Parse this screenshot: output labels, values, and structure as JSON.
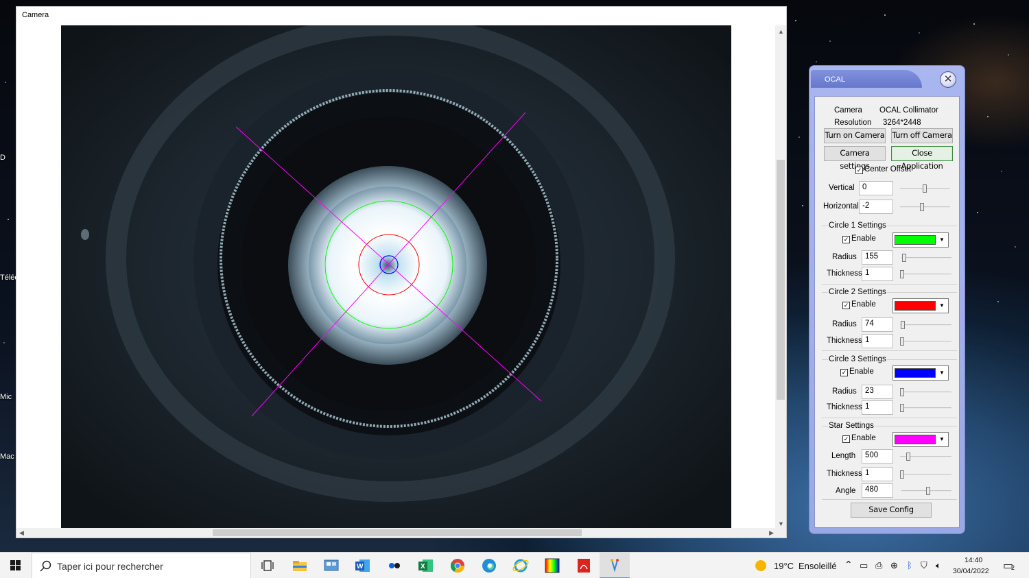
{
  "desktop": {
    "labels": [
      "D",
      "Téléc",
      "Mic",
      "Mac"
    ]
  },
  "camera_window": {
    "title": "Camera"
  },
  "ocal": {
    "title": "OCAL",
    "camera_label": "Camera",
    "camera_value": "OCAL Collimator",
    "resolution_label": "Resolution",
    "resolution_value": "3264*2448",
    "buttons": {
      "turn_on": "Turn on Camera",
      "turn_off": "Turn off Camera",
      "settings": "Camera settings",
      "close_app": "Close Application",
      "save": "Save Config"
    },
    "center_offset": {
      "label": "Center Offset",
      "checked": true,
      "vertical_label": "Vertical",
      "vertical_value": "0",
      "horizontal_label": "Horizontal",
      "horizontal_value": "-2"
    },
    "circle1": {
      "title": "Circle 1 Settings",
      "enable_label": "Enable",
      "color": "#00ff00",
      "radius_label": "Radius",
      "radius": "155",
      "thickness_label": "Thickness",
      "thickness": "1"
    },
    "circle2": {
      "title": "Circle 2 Settings",
      "enable_label": "Enable",
      "color": "#ff0000",
      "radius_label": "Radius",
      "radius": "74",
      "thickness_label": "Thickness",
      "thickness": "1"
    },
    "circle3": {
      "title": "Circle 3 Settings",
      "enable_label": "Enable",
      "color": "#0000ff",
      "radius_label": "Radius",
      "radius": "23",
      "thickness_label": "Thickness",
      "thickness": "1"
    },
    "star": {
      "title": "Star Settings",
      "enable_label": "Enable",
      "color": "#ff00ff",
      "length_label": "Length",
      "length": "500",
      "thickness_label": "Thickness",
      "thickness": "1",
      "angle_label": "Angle",
      "angle": "480"
    }
  },
  "taskbar": {
    "search_placeholder": "Taper ici pour rechercher",
    "weather_temp": "19°C",
    "weather_text": "Ensoleillé",
    "time": "14:40",
    "date": "30/04/2022",
    "notification_count": "2",
    "pinned_apps": [
      "task-view",
      "file-explorer",
      "control-panel",
      "word",
      "flickr",
      "excel",
      "chrome",
      "edge",
      "internet-explorer",
      "color-app",
      "acrobat",
      "paint-app"
    ]
  }
}
